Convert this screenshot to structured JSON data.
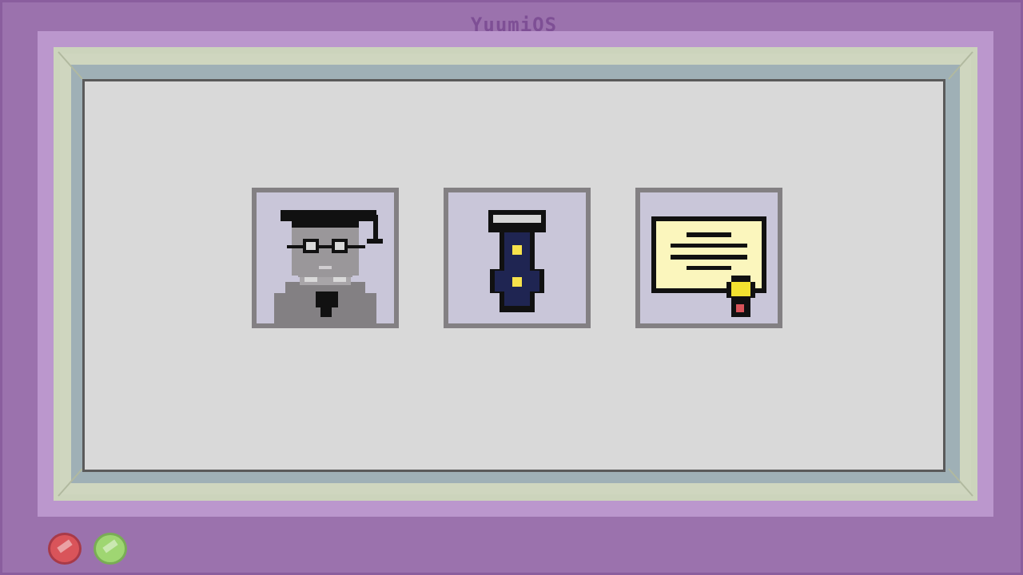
{
  "app": {
    "os_name": "YuumiOS"
  },
  "tiles": [
    {
      "icon": "graduate-portrait-icon"
    },
    {
      "icon": "necktie-icon"
    },
    {
      "icon": "diploma-certificate-icon"
    }
  ],
  "buttons": {
    "red": {
      "icon": "red-round-button",
      "color": "#d9545a"
    },
    "green": {
      "icon": "green-round-button",
      "color": "#9fd672"
    }
  },
  "colors": {
    "console": "#9b72ad",
    "screen_bezel": "#bb97cd",
    "screen_bg": "#d9d9d9",
    "tile_bg": "#c9c6d9",
    "tile_border": "#838083"
  }
}
